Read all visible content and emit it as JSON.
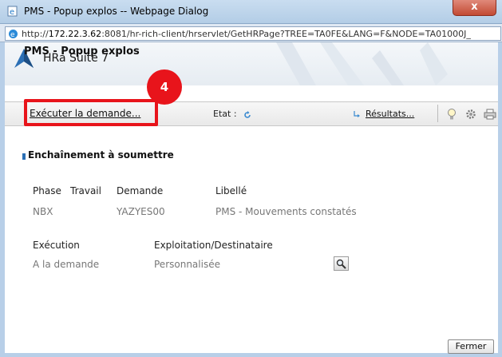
{
  "window": {
    "title": "PMS - Popup explos -- Webpage Dialog",
    "close_glyph": "x"
  },
  "address": {
    "url_prefix": "http://",
    "url_host": "172.22.3.62",
    "url_rest": ":8081/hr-rich-client/hrservlet/GetHRPage?TREE=TA0FE&LANG=F&NODE=TA01000J_"
  },
  "app": {
    "suite_name": "HRa Suite 7",
    "popup_title": "PMS - Popup explos"
  },
  "toolbar": {
    "execute_label": "Exécuter la demande...",
    "state_label": "Etat :",
    "results_label": "Résultats..."
  },
  "callout": {
    "number": "4",
    "color": "#e8141b"
  },
  "section": {
    "title": "Enchaînement à soumettre",
    "columns": [
      "Phase",
      "Travail",
      "Demande",
      "Libellé"
    ],
    "row": {
      "phase": "NBX",
      "demande": "YAZYES00",
      "libelle": "PMS - Mouvements constatés"
    },
    "execution_label": "Exécution",
    "exploitation_label": "Exploitation/Destinataire",
    "execution_value": "A la demande",
    "exploitation_value": "Personnalisée"
  },
  "footer": {
    "close_label": "Fermer"
  },
  "colors": {
    "accent": "#2b6fb5",
    "titlebar": "#b3cde6",
    "close": "#c24a33"
  }
}
